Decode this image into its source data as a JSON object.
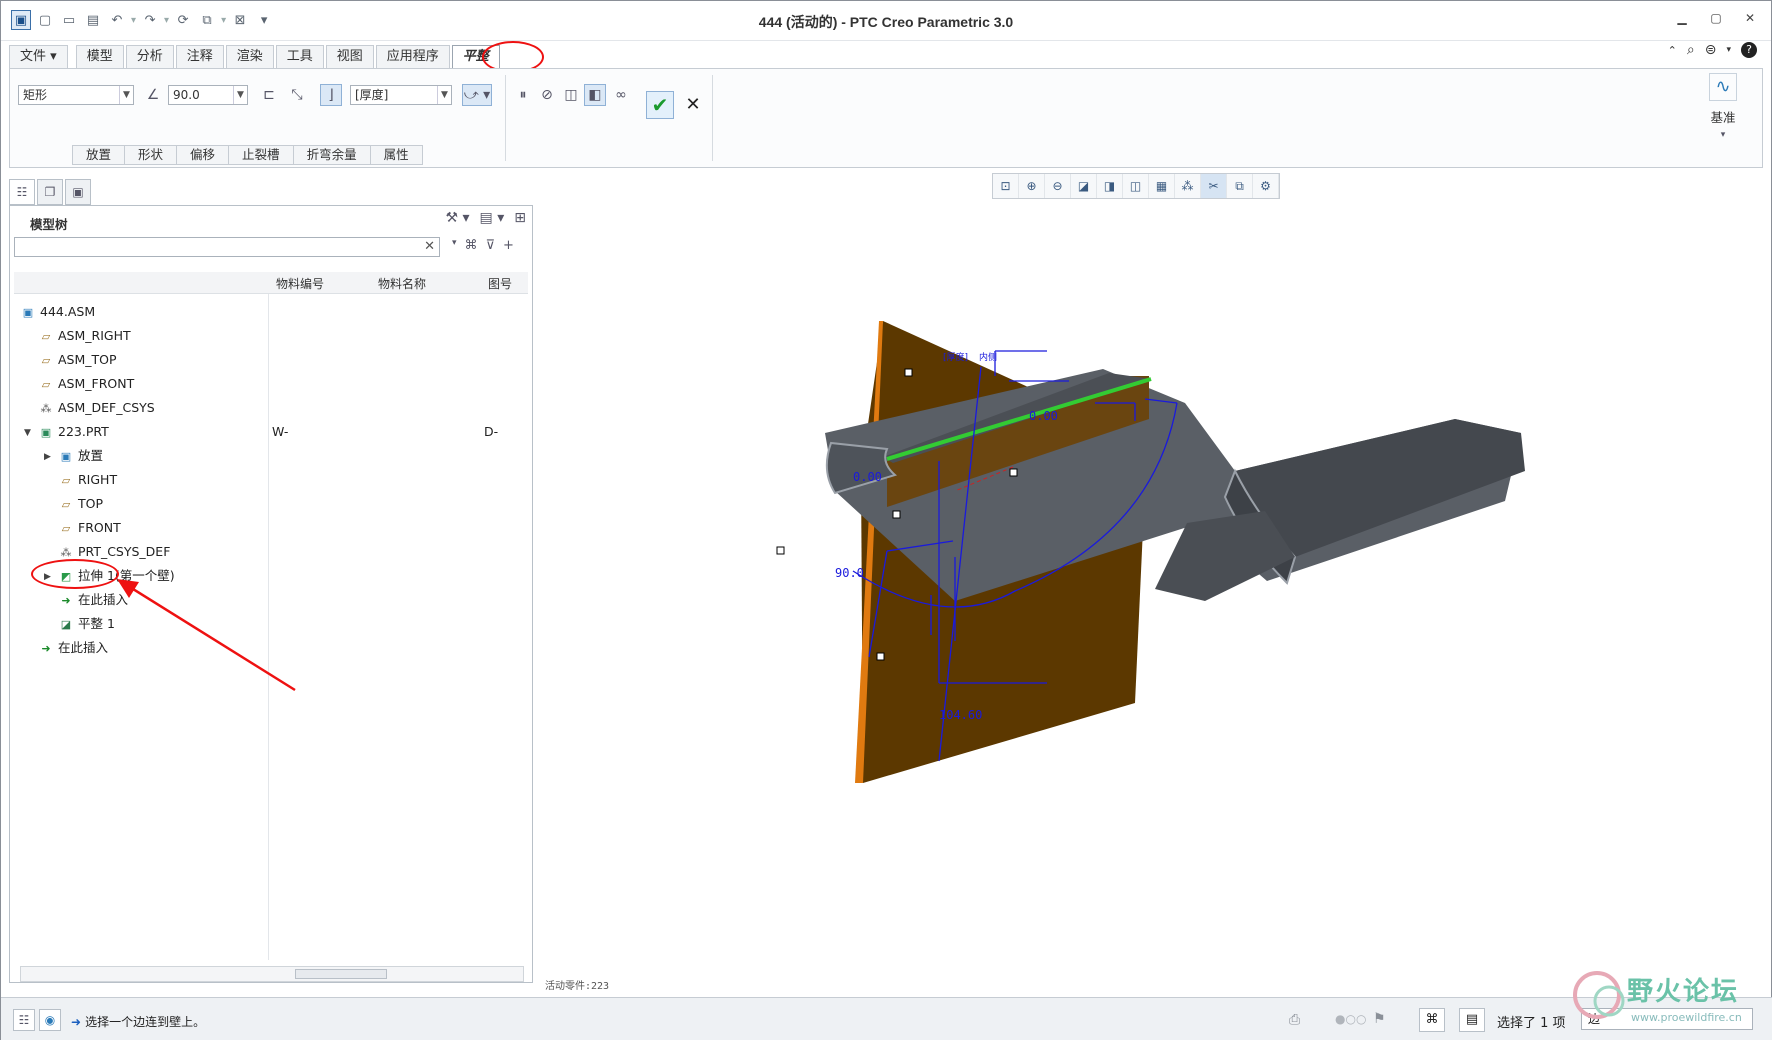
{
  "window": {
    "title": "444 (活动的) - PTC Creo Parametric 3.0"
  },
  "ribbon": {
    "tabs": [
      {
        "label": "文件"
      },
      {
        "label": "模型"
      },
      {
        "label": "分析"
      },
      {
        "label": "注释"
      },
      {
        "label": "渲染"
      },
      {
        "label": "工具"
      },
      {
        "label": "视图"
      },
      {
        "label": "应用程序"
      },
      {
        "label": "平整"
      }
    ],
    "active_tab": "平整",
    "shape_dropdown": "矩形",
    "angle_value": "90.0",
    "thickness_dropdown": "[厚度]",
    "subtabs": [
      "放置",
      "形状",
      "偏移",
      "止裂槽",
      "折弯余量",
      "属性"
    ],
    "datum_label": "基准"
  },
  "model_tree": {
    "title": "模型树",
    "search_placeholder": "",
    "columns": [
      "物料编号",
      "物料名称",
      "图号"
    ],
    "items": [
      {
        "label": "444.ASM",
        "icon": "assembly-icon"
      },
      {
        "label": "ASM_RIGHT",
        "icon": "datum-plane-icon"
      },
      {
        "label": "ASM_TOP",
        "icon": "datum-plane-icon"
      },
      {
        "label": "ASM_FRONT",
        "icon": "datum-plane-icon"
      },
      {
        "label": "ASM_DEF_CSYS",
        "icon": "csys-icon"
      },
      {
        "label": "223.PRT",
        "icon": "part-icon",
        "item_no": "W-",
        "drawing_no": "D-"
      },
      {
        "label": "放置",
        "icon": "placement-icon"
      },
      {
        "label": "RIGHT",
        "icon": "datum-plane-icon"
      },
      {
        "label": "TOP",
        "icon": "datum-plane-icon"
      },
      {
        "label": "FRONT",
        "icon": "datum-plane-icon"
      },
      {
        "label": "PRT_CSYS_DEF",
        "icon": "csys-icon"
      },
      {
        "label": "拉伸 1(第一个壁)",
        "icon": "extrude-wall-icon"
      },
      {
        "label": "在此插入",
        "icon": "insert-here-icon"
      },
      {
        "label": "平整 1",
        "icon": "flat-wall-icon"
      },
      {
        "label": "在此插入",
        "icon": "insert-here-icon"
      }
    ]
  },
  "graphics": {
    "active_part": "活动零件:223",
    "dim_top": "0.00",
    "dim_right": "0.00",
    "dim_angle": "90.0",
    "dim_length": "104.60",
    "label_thickness": "[厚度]",
    "label_inside": "内侧"
  },
  "status": {
    "message": "选择一个边连到壁上。",
    "selection_count": "选择了 1 项",
    "filter_value": "边"
  },
  "watermark": {
    "text": "野火论坛",
    "url": "www.proewildfire.cn"
  },
  "colors": {
    "accent": "#1a5fbf",
    "annotation_red": "#e11111",
    "part_brown": "#5c3800",
    "part_edge": "#e07a10",
    "dim_blue": "#1a1adc",
    "green_edge": "#33cc33",
    "steel": "#5a5f66"
  }
}
